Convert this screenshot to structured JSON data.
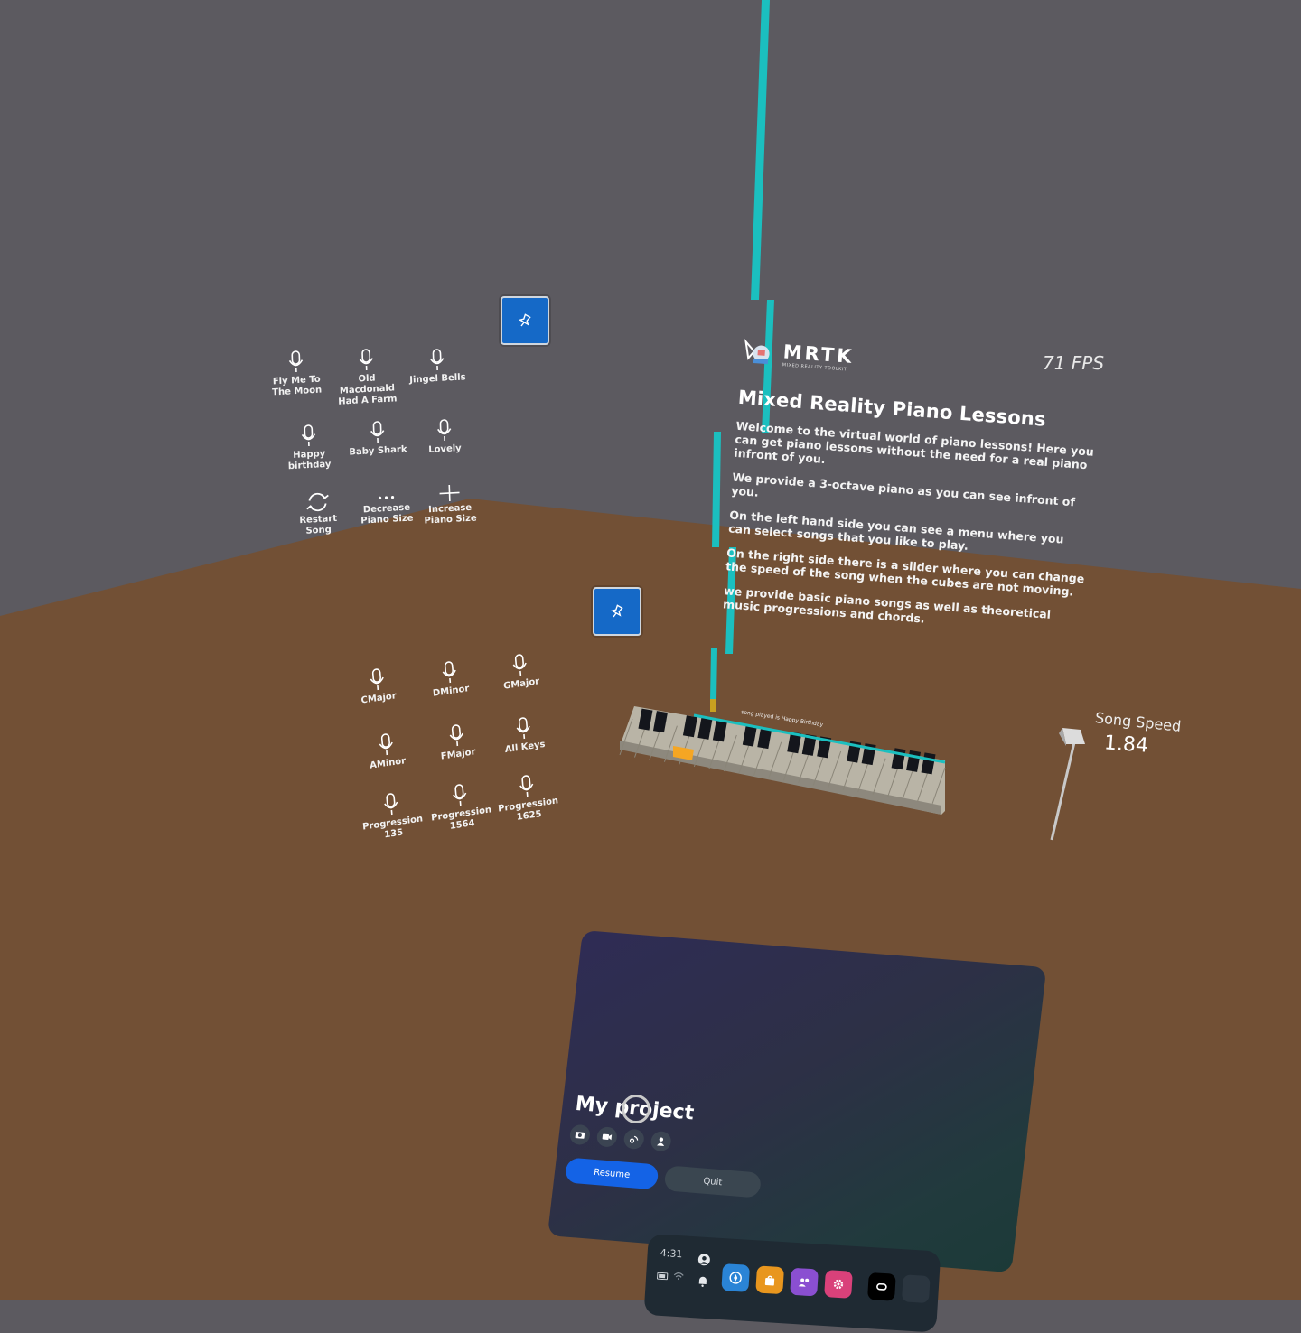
{
  "menu_songs": {
    "items": [
      {
        "label": "Fly Me To The Moon"
      },
      {
        "label": "Old Macdonald Had A Farm"
      },
      {
        "label": "Jingel Bells"
      },
      {
        "label": "Happy birthday"
      },
      {
        "label": "Baby Shark"
      },
      {
        "label": "Lovely"
      },
      {
        "label": "Restart Song"
      },
      {
        "label": "Decrease Piano Size"
      },
      {
        "label": "Increase Piano Size"
      }
    ]
  },
  "menu_chords": {
    "items": [
      {
        "label": "CMajor"
      },
      {
        "label": "DMinor"
      },
      {
        "label": "GMajor"
      },
      {
        "label": "AMinor"
      },
      {
        "label": "FMajor"
      },
      {
        "label": "All Keys"
      },
      {
        "label": "Progression 135"
      },
      {
        "label": "Progression 1564"
      },
      {
        "label": "Progression 1625"
      }
    ]
  },
  "info": {
    "logo_text": "MRTK",
    "logo_subtext": "MIXED REALITY TOOLKIT",
    "fps": "71 FPS",
    "title": "Mixed Reality Piano Lessons",
    "paragraphs": [
      "Welcome to the virtual world of piano lessons! Here you can get piano lessons without the need for a real piano infront of you.",
      "We provide a 3-octave piano as you can see infront of you.",
      "On the left hand side you can see a menu where you can select songs that you like to play.",
      "On the right side there is a slider where you can change the speed of the song when the cubes are not moving.",
      "we provide basic piano songs as well as theoretical music progressions and chords."
    ]
  },
  "piano": {
    "now_playing": "song played is Happy Birthday",
    "highlight_color": "#f5a623"
  },
  "slider": {
    "label": "Song Speed",
    "value": "1.84",
    "level": 0.92
  },
  "dialog": {
    "title": "My project",
    "icons": [
      "camera-icon",
      "video-icon",
      "cast-icon",
      "people-icon"
    ],
    "resume_label": "Resume",
    "quit_label": "Quit"
  },
  "taskbar": {
    "time": "4:31",
    "apps": [
      "explore-icon",
      "store-icon",
      "people-icon",
      "settings-icon",
      "oculus-icon"
    ]
  },
  "colors": {
    "wall": "#5c5a60",
    "floor": "#725035",
    "falling_notes": "#1bbfbf",
    "accent": "#1463e6"
  }
}
